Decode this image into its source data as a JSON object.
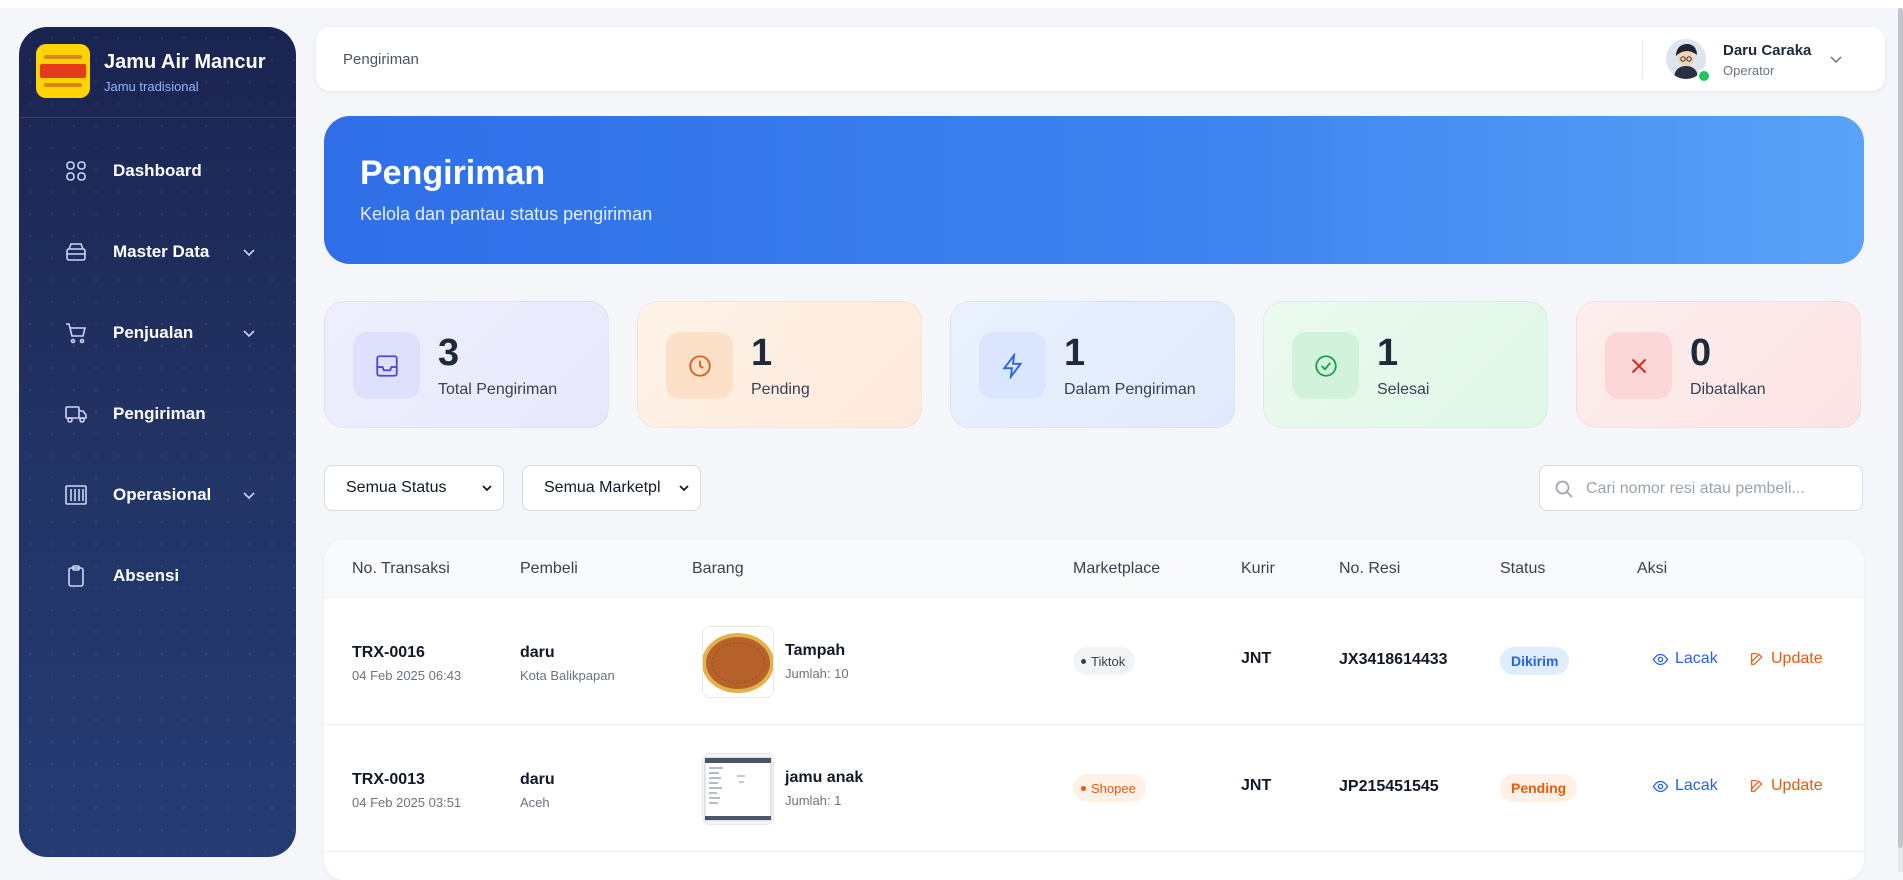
{
  "app": {
    "name": "Jamu Air Mancur",
    "subtitle": "Jamu tradisional"
  },
  "sidebar": {
    "items": [
      {
        "label": "Dashboard",
        "icon": "grid-icon",
        "has_submenu": false
      },
      {
        "label": "Master Data",
        "icon": "database-icon",
        "has_submenu": true
      },
      {
        "label": "Penjualan",
        "icon": "cart-icon",
        "has_submenu": true
      },
      {
        "label": "Pengiriman",
        "icon": "truck-icon",
        "has_submenu": false,
        "active": true
      },
      {
        "label": "Operasional",
        "icon": "columns-icon",
        "has_submenu": true
      },
      {
        "label": "Absensi",
        "icon": "clipboard-icon",
        "has_submenu": false
      }
    ]
  },
  "header": {
    "breadcrumb": "Pengiriman",
    "user": {
      "name": "Daru Caraka",
      "role": "Operator",
      "online": true
    }
  },
  "hero": {
    "title": "Pengiriman",
    "subtitle": "Kelola dan pantau status pengiriman"
  },
  "stats": [
    {
      "value": "3",
      "label": "Total Pengiriman",
      "icon": "inbox-icon",
      "accent": "#4f46e5"
    },
    {
      "value": "1",
      "label": "Pending",
      "icon": "clock-icon",
      "accent": "#ea580c"
    },
    {
      "value": "1",
      "label": "Dalam Pengiriman",
      "icon": "bolt-icon",
      "accent": "#2563eb"
    },
    {
      "value": "1",
      "label": "Selesai",
      "icon": "check-circle-icon",
      "accent": "#16a34a"
    },
    {
      "value": "0",
      "label": "Dibatalkan",
      "icon": "x-icon",
      "accent": "#dc2626"
    }
  ],
  "filters": {
    "status": "Semua Status",
    "marketplace": "Semua Marketpl",
    "search_placeholder": "Cari nomor resi atau pembeli..."
  },
  "table": {
    "columns": [
      "No. Transaksi",
      "Pembeli",
      "Barang",
      "Marketplace",
      "Kurir",
      "No. Resi",
      "Status",
      "Aksi"
    ],
    "rows": [
      {
        "trx": "TRX-0016",
        "date": "04 Feb 2025 06:43",
        "buyer": "daru",
        "city": "Kota Balikpapan",
        "item": "Tampah",
        "qty": "Jumlah: 10",
        "marketplace": "Tiktok",
        "courier": "JNT",
        "resi": "JX3418614433",
        "status": "Dikirim",
        "actions": {
          "track": "Lacak",
          "update": "Update"
        }
      },
      {
        "trx": "TRX-0013",
        "date": "04 Feb 2025 03:51",
        "buyer": "daru",
        "city": "Aceh",
        "item": "jamu anak",
        "qty": "Jumlah: 1",
        "marketplace": "Shopee",
        "courier": "JNT",
        "resi": "JP215451545",
        "status": "Pending",
        "actions": {
          "track": "Lacak",
          "update": "Update"
        }
      }
    ]
  },
  "colors": {
    "primary": "#2f6ee8",
    "tiktok_badge_bg": "#f3f4f6",
    "shopee_badge_bg": "#fff1e6",
    "shopee_text": "#ea580c",
    "dikirim_bg": "#e0edff",
    "dikirim_text": "#2563eb",
    "pending_bg": "#fff1e6",
    "pending_text": "#ea580c",
    "track_link": "#2563eb",
    "update_link": "#ea580c"
  }
}
